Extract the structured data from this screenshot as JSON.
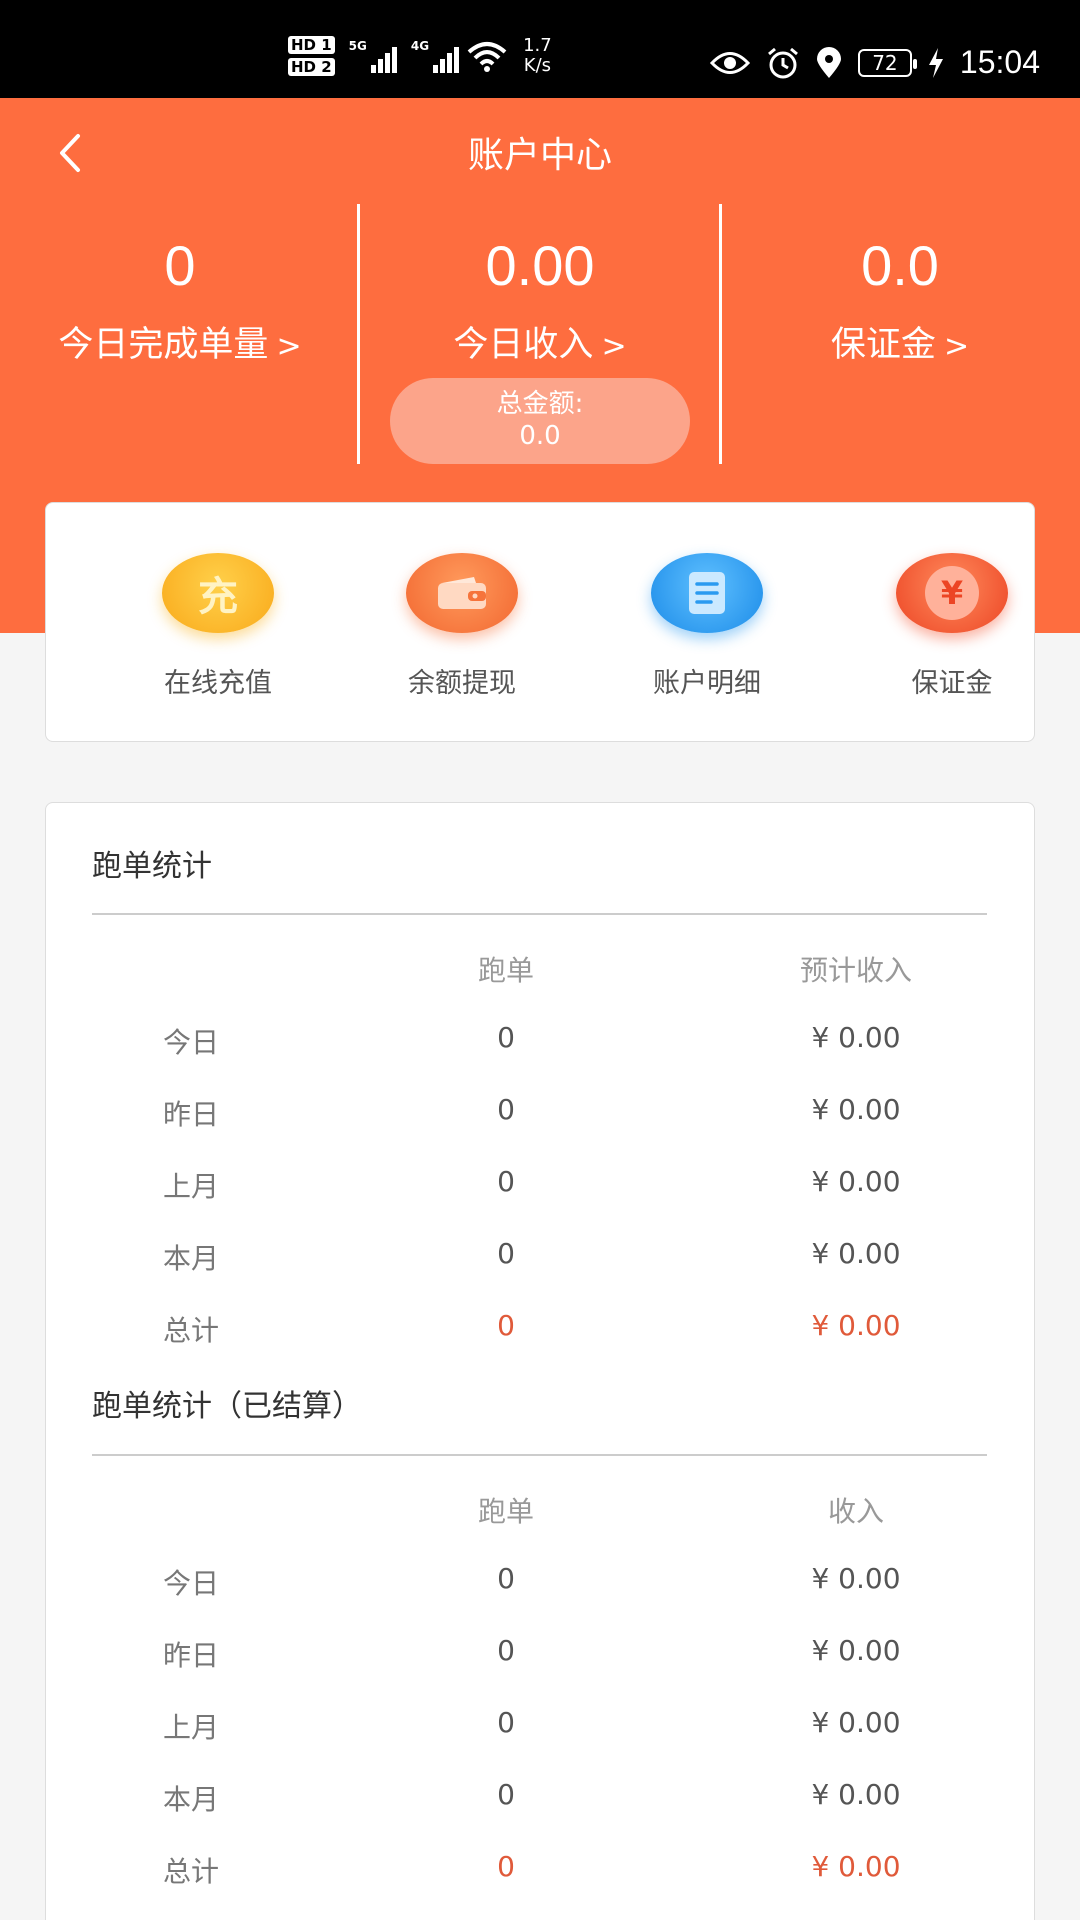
{
  "status_bar": {
    "hd1": "HD 1",
    "hd2": "HD 2",
    "net1": "5G",
    "net2": "4G",
    "speed_value": "1.7",
    "speed_unit": "K/s",
    "battery": "72",
    "time": "15:04"
  },
  "header": {
    "title": "账户中心",
    "stats": [
      {
        "value": "0",
        "label": "今日完成单量"
      },
      {
        "value": "0.00",
        "label": "今日收入"
      },
      {
        "value": "0.0",
        "label": "保证金"
      }
    ],
    "total_label": "总金额:",
    "total_value": "0.0"
  },
  "actions": [
    {
      "label": "在线充值",
      "icon": "recharge-icon",
      "glyph": "充",
      "color": "#f9b21c"
    },
    {
      "label": "余额提现",
      "icon": "wallet-icon",
      "glyph": "",
      "color": "#f6743b"
    },
    {
      "label": "账户明细",
      "icon": "document-icon",
      "glyph": "",
      "color": "#2a9af0"
    },
    {
      "label": "保证金",
      "icon": "yuan-icon",
      "glyph": "¥",
      "color": "#f4532f"
    }
  ],
  "stats_section": {
    "title": "跑单统计",
    "col_count": "跑单",
    "col_amount": "预计收入",
    "rows": [
      {
        "label": "今日",
        "count": "0",
        "amount": "¥  0.00"
      },
      {
        "label": "昨日",
        "count": "0",
        "amount": "¥  0.00"
      },
      {
        "label": "上月",
        "count": "0",
        "amount": "¥  0.00"
      },
      {
        "label": "本月",
        "count": "0",
        "amount": "¥  0.00"
      },
      {
        "label": "总计",
        "count": "0",
        "amount": "¥  0.00"
      }
    ]
  },
  "settled_section": {
    "title": "跑单统计（已结算）",
    "col_count": "跑单",
    "col_amount": "收入",
    "rows": [
      {
        "label": "今日",
        "count": "0",
        "amount": "¥  0.00"
      },
      {
        "label": "昨日",
        "count": "0",
        "amount": "¥  0.00"
      },
      {
        "label": "上月",
        "count": "0",
        "amount": "¥  0.00"
      },
      {
        "label": "本月",
        "count": "0",
        "amount": "¥  0.00"
      },
      {
        "label": "总计",
        "count": "0",
        "amount": "¥  0.00"
      }
    ]
  },
  "colors": {
    "accent": "#fe6d3f",
    "total_red": "#e05a3a"
  }
}
